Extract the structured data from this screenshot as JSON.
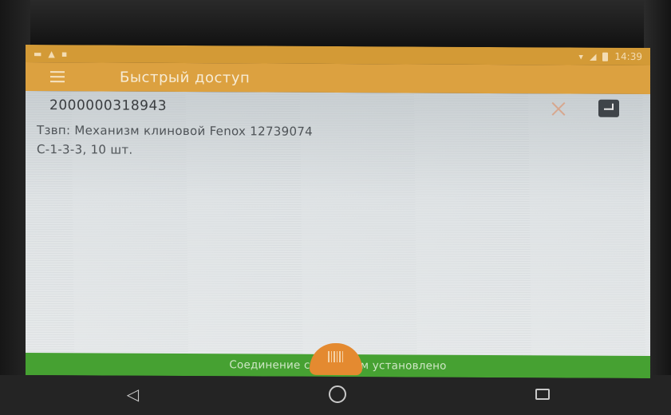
{
  "status_bar": {
    "time": "14:39",
    "left_icons": [
      "notification-icon",
      "lock-icon",
      "image-icon"
    ],
    "right_icons": [
      "wifi-icon",
      "signal-icon",
      "battery-icon"
    ]
  },
  "app_bar": {
    "title": "Быстрый доступ",
    "menu_icon": "hamburger-menu-icon"
  },
  "search": {
    "barcode_value": "2000000318943",
    "clear_icon": "close-icon",
    "enter_icon": "keyboard-return-icon"
  },
  "result": {
    "line1": "Тзвп: Механизм клиновой Fenox 12739074",
    "line2": "С-1-3-3, 10 шт."
  },
  "fab": {
    "icon": "barcode-scan-icon"
  },
  "connection": {
    "status_text": "Соединение с сервером установлено"
  },
  "colors": {
    "app_bar": "#dca140",
    "status_bar": "#d39a36",
    "connection_bar": "#46a132",
    "fab": "#e48a30"
  },
  "nav": {
    "back_icon": "back-triangle-icon",
    "home_icon": "home-circle-icon",
    "recents_icon": "recents-square-icon"
  }
}
